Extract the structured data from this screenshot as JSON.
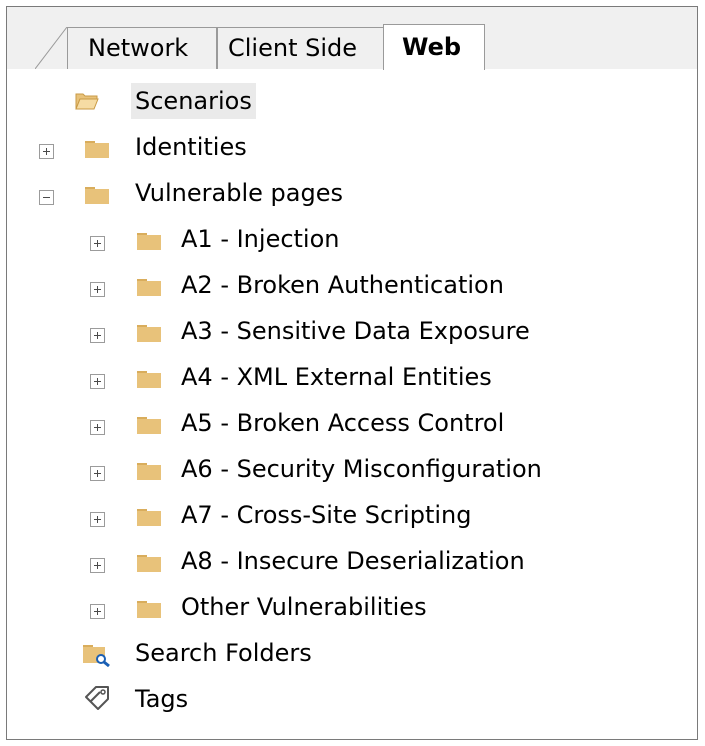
{
  "tabs": [
    {
      "label": "Network"
    },
    {
      "label": "Client Side"
    },
    {
      "label": "Web",
      "active": true
    }
  ],
  "tree": {
    "scenarios": "Scenarios",
    "identities": "Identities",
    "vulnerable_pages": "Vulnerable pages",
    "children": [
      {
        "label": "A1 - Injection"
      },
      {
        "label": "A2 - Broken Authentication"
      },
      {
        "label": "A3 - Sensitive Data Exposure"
      },
      {
        "label": "A4 - XML External Entities"
      },
      {
        "label": "A5 - Broken Access Control"
      },
      {
        "label": "A6 - Security Misconfiguration"
      },
      {
        "label": "A7 - Cross-Site Scripting"
      },
      {
        "label": "A8 - Insecure Deserialization"
      },
      {
        "label": "Other Vulnerabilities"
      }
    ],
    "search_folders": "Search Folders",
    "tags": "Tags"
  },
  "colors": {
    "folder": "#e8c27a",
    "folder_dark": "#d9ad5c",
    "selection": "#eaeaea",
    "search_glass": "#1a5fb4"
  }
}
